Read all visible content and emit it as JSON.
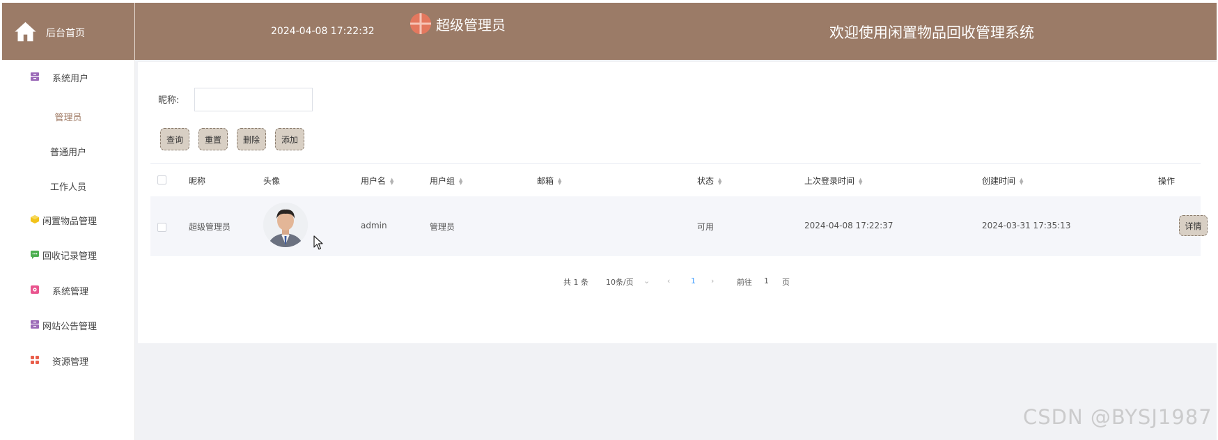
{
  "header": {
    "home_label": "后台首页",
    "datetime": "2024-04-08 17:22:32",
    "current_user": "超级管理员",
    "welcome": "欢迎使用闲置物品回收管理系统"
  },
  "sidebar": {
    "groups": [
      {
        "label": "系统用户",
        "icon": "archive-icon",
        "color": "#9b6ab8"
      },
      {
        "label": "闲置物品管理",
        "icon": "cube-icon",
        "color": "#f2c31b"
      },
      {
        "label": "回收记录管理",
        "icon": "chat-icon",
        "color": "#4caf50"
      },
      {
        "label": "系统管理",
        "icon": "settings-box-icon",
        "color": "#e9548e"
      },
      {
        "label": "网站公告管理",
        "icon": "archive-icon",
        "color": "#9b6ab8"
      },
      {
        "label": "资源管理",
        "icon": "grid-icon",
        "color": "#e95e4b"
      }
    ],
    "sub_items": [
      {
        "label": "管理员",
        "active": true
      },
      {
        "label": "普通用户",
        "active": false
      },
      {
        "label": "工作人员",
        "active": false
      }
    ]
  },
  "search": {
    "label": "昵称:",
    "value": ""
  },
  "buttons": {
    "query": "查询",
    "reset": "重置",
    "delete": "删除",
    "add": "添加"
  },
  "table": {
    "columns": [
      "昵称",
      "头像",
      "用户名",
      "用户组",
      "邮箱",
      "状态",
      "上次登录时间",
      "创建时间",
      "操作"
    ],
    "rows": [
      {
        "nickname": "超级管理员",
        "username": "admin",
        "group": "管理员",
        "email": "",
        "status": "可用",
        "last_login": "2024-04-08 17:22:37",
        "created": "2024-03-31 17:35:13",
        "action": "详情"
      }
    ]
  },
  "pagination": {
    "total": "共 1 条",
    "page_size": "10条/页",
    "current_page": "1",
    "goto_prefix": "前往",
    "goto_value": "1",
    "goto_suffix": "页"
  },
  "watermark": "CSDN @BYSJ1987",
  "colors": {
    "header_bg": "#9b7b67",
    "accent": "#a07b65",
    "button_bg": "#d8cfc4",
    "link_blue": "#409eff"
  }
}
